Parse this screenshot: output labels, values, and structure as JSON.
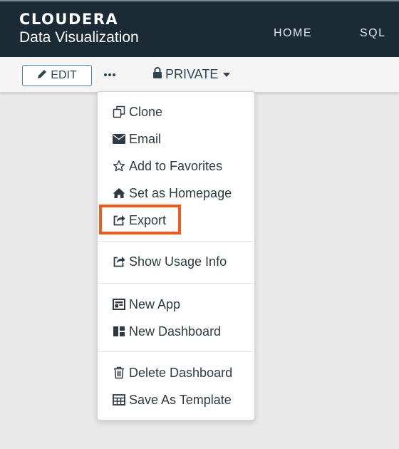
{
  "header": {
    "brand": "CLOUDERA",
    "product": "Data Visualization",
    "nav": [
      "HOME",
      "SQL"
    ]
  },
  "toolbar": {
    "edit_label": "EDIT",
    "more_icon": "ellipsis-icon",
    "visibility_label": "PRIVATE"
  },
  "menu": {
    "items": [
      {
        "label": "Clone",
        "icon": "clone-icon"
      },
      {
        "label": "Email",
        "icon": "envelope-icon"
      },
      {
        "label": "Add to Favorites",
        "icon": "star-icon"
      },
      {
        "label": "Set as Homepage",
        "icon": "home-icon"
      },
      {
        "label": "Export",
        "icon": "export-icon"
      },
      {
        "label": "Show Usage Info",
        "icon": "export-icon"
      },
      {
        "label": "New App",
        "icon": "app-icon"
      },
      {
        "label": "New Dashboard",
        "icon": "dashboard-icon"
      },
      {
        "label": "Delete Dashboard",
        "icon": "trash-icon"
      },
      {
        "label": "Save As Template",
        "icon": "table-icon"
      }
    ],
    "highlighted_item": "Export"
  },
  "colors": {
    "header_bg": "#1b2b36",
    "highlight": "#f05a1a",
    "accent": "#3d7dbd"
  }
}
